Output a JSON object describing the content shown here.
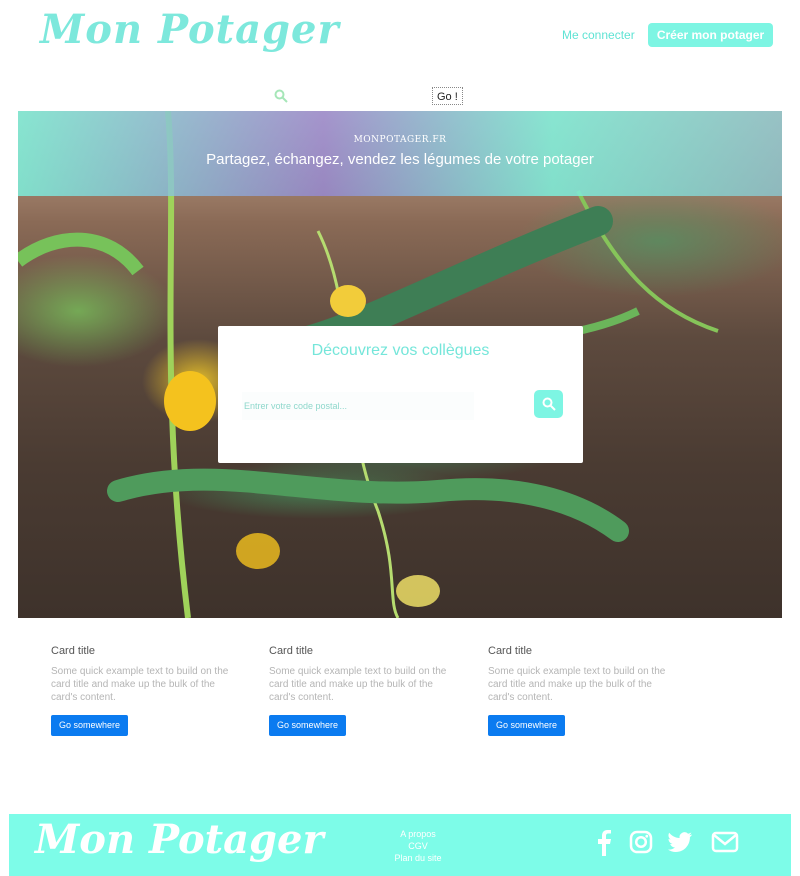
{
  "header": {
    "logo": "Mon Potager",
    "login_label": "Me connecter",
    "create_label": "Créer mon potager"
  },
  "search": {
    "placeholder": "",
    "go_label": "Go !"
  },
  "hero": {
    "site_name": "MONPOTAGER.FR",
    "tagline": "Partagez, échangez, vendez les légumes de votre potager"
  },
  "discover": {
    "title": "Découvrez vos collègues",
    "postal_placeholder": "Entrer votre code postal..."
  },
  "cards": [
    {
      "title": "Card title",
      "text": "Some quick example text to build on the card title and make up the bulk of the card's content.",
      "button": "Go somewhere"
    },
    {
      "title": "Card title",
      "text": "Some quick example text to build on the card title and make up the bulk of the card's content.",
      "button": "Go somewhere"
    },
    {
      "title": "Card title",
      "text": "Some quick example text to build on the card title and make up the bulk of the card's content.",
      "button": "Go somewhere"
    }
  ],
  "footer": {
    "logo": "Mon Potager",
    "links": [
      "A propos",
      "CGV",
      "Plan du site"
    ],
    "social": [
      "facebook-icon",
      "instagram-icon",
      "twitter-icon",
      "mail-icon"
    ]
  },
  "colors": {
    "accent": "#7df5e3",
    "footer_bg": "#7dfce8",
    "card_button": "#0b7bf0"
  }
}
